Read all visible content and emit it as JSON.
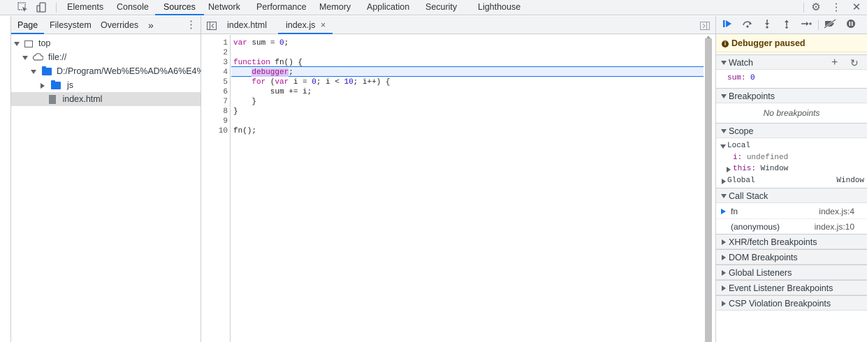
{
  "toolbar": {
    "tabs": [
      "Elements",
      "Console",
      "Sources",
      "Network",
      "Performance",
      "Memory",
      "Application",
      "Security",
      "Lighthouse"
    ],
    "active_tab": "Sources",
    "icons": [
      "inspect-element-icon",
      "device-toolbar-icon",
      "settings-gear-icon",
      "more-options-icon",
      "close-icon"
    ]
  },
  "navigator": {
    "tabs": [
      "Page",
      "Filesystem",
      "Overrides"
    ],
    "more": "»",
    "tree": {
      "top": "top",
      "file_root": "file://",
      "folder_path": "D:/Program/Web%E5%AD%A6%E4%B9",
      "js_folder": "js",
      "selected_file": "index.html"
    }
  },
  "editor": {
    "tabs": [
      "index.html",
      "index.js"
    ],
    "active_tab": "index.js",
    "close_glyph": "×",
    "line_numbers": [
      "1",
      "2",
      "3",
      "4",
      "5",
      "6",
      "7",
      "8",
      "9",
      "10"
    ],
    "paused_line": 4
  },
  "debugger": {
    "paused_message": "Debugger paused",
    "watch": {
      "title": "Watch",
      "add_glyph": "+",
      "refresh_glyph": "↻",
      "expr_name": "sum",
      "expr_value": "0"
    },
    "breakpoints": {
      "title": "Breakpoints",
      "empty": "No breakpoints"
    },
    "scope": {
      "title": "Scope",
      "local_label": "Local",
      "local_i_name": "i",
      "local_i_value": "undefined",
      "local_this_name": "this",
      "local_this_value": "Window",
      "global_label": "Global",
      "global_value": "Window"
    },
    "call_stack": {
      "title": "Call Stack",
      "frames": [
        {
          "name": "fn",
          "location": "index.js:4"
        },
        {
          "name": "(anonymous)",
          "location": "index.js:10"
        }
      ]
    },
    "collapsed_sections": [
      "XHR/fetch Breakpoints",
      "DOM Breakpoints",
      "Global Listeners",
      "Event Listener Breakpoints",
      "CSP Violation Breakpoints"
    ]
  }
}
